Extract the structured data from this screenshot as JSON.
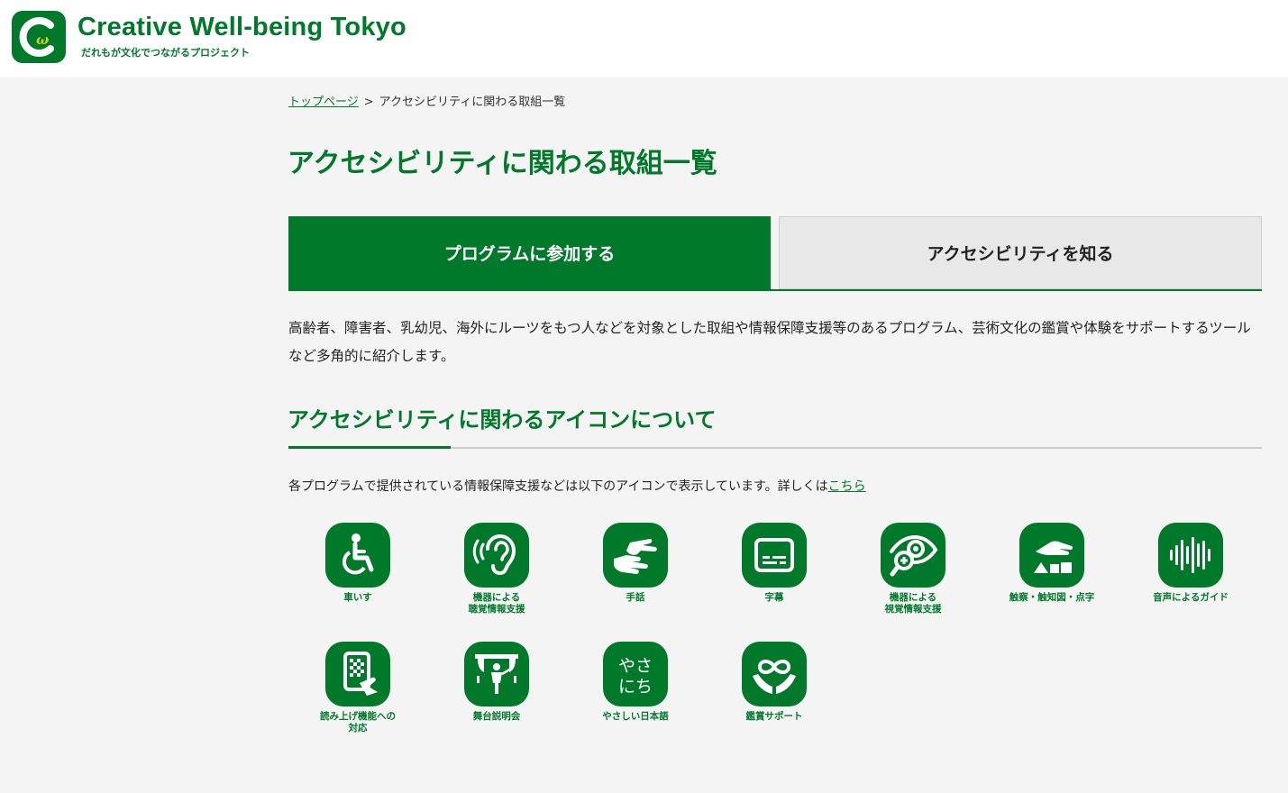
{
  "header": {
    "title": "Creative Well-being Tokyo",
    "subtitle": "だれもが文化でつながるプロジェクト",
    "logo_icon": "cwt-logo-icon"
  },
  "breadcrumb": {
    "home": "トップページ",
    "separator": ">",
    "current": "アクセシビリティに関わる取組一覧"
  },
  "page_title": "アクセシビリティに関わる取組一覧",
  "tabs": [
    {
      "label": "プログラムに参加する",
      "active": true
    },
    {
      "label": "アクセシビリティを知る",
      "active": false
    }
  ],
  "intro": "高齢者、障害者、乳幼児、海外にルーツをもつ人などを対象とした取組や情報保障支援等のあるプログラム、芸術文化の鑑賞や体験をサポートするツールなど多角的に紹介します。",
  "section": {
    "title": "アクセシビリティに関わるアイコンについて",
    "note": "各プログラムで提供されている情報保障支援などは以下のアイコンで表示しています。詳しくは",
    "link": "こちら"
  },
  "icons": [
    {
      "label": "車いす",
      "icon": "wheelchair-icon"
    },
    {
      "label": "機器による\n聴覚情報支援",
      "icon": "hearing-assist-icon"
    },
    {
      "label": "手話",
      "icon": "sign-language-icon"
    },
    {
      "label": "字幕",
      "icon": "subtitles-icon"
    },
    {
      "label": "機器による\n視覚情報支援",
      "icon": "visual-assist-icon"
    },
    {
      "label": "触察・触知図・点字",
      "icon": "tactile-icon"
    },
    {
      "label": "音声によるガイド",
      "icon": "audio-guide-icon"
    },
    {
      "label": "読み上げ機能への\n対応",
      "icon": "text-to-speech-icon"
    },
    {
      "label": "舞台説明会",
      "icon": "stage-tour-icon"
    },
    {
      "label": "やさしい日本語",
      "icon": "easy-japanese-icon",
      "glyph_top": "やさ",
      "glyph_bottom": "にち"
    },
    {
      "label": "鑑賞サポート",
      "icon": "viewing-support-icon"
    }
  ],
  "colors": {
    "brand_green": "#00792b",
    "brand_yellow": "#c9d400",
    "background": "#f4f4f4",
    "inactive_tab": "#e8e8e8"
  }
}
